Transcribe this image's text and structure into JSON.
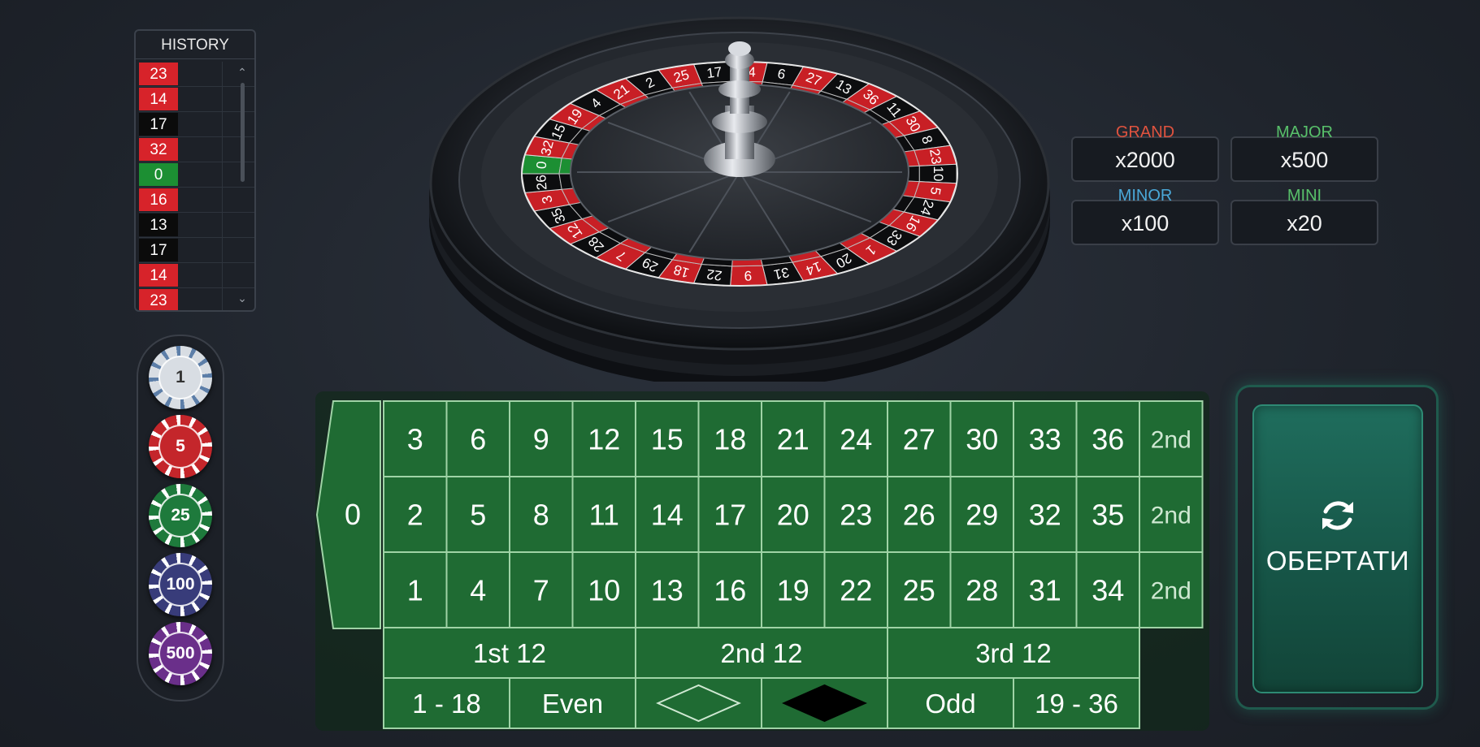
{
  "history": {
    "title": "HISTORY",
    "items": [
      {
        "num": "23",
        "color": "red"
      },
      {
        "num": "14",
        "color": "red"
      },
      {
        "num": "17",
        "color": "black"
      },
      {
        "num": "32",
        "color": "red"
      },
      {
        "num": "0",
        "color": "green"
      },
      {
        "num": "16",
        "color": "red"
      },
      {
        "num": "13",
        "color": "black"
      },
      {
        "num": "17",
        "color": "black"
      },
      {
        "num": "14",
        "color": "red"
      },
      {
        "num": "23",
        "color": "red"
      }
    ]
  },
  "chips": [
    {
      "value": "1",
      "color": "#d8dde3",
      "text": "#333333",
      "edge": "#5c7ea8"
    },
    {
      "value": "5",
      "color": "#c4262b",
      "text": "#ffffff",
      "edge": "#ffffff"
    },
    {
      "value": "25",
      "color": "#1e7a3c",
      "text": "#ffffff",
      "edge": "#ffffff"
    },
    {
      "value": "100",
      "color": "#383c7a",
      "text": "#ffffff",
      "edge": "#ffffff"
    },
    {
      "value": "500",
      "color": "#6a2f8a",
      "text": "#ffffff",
      "edge": "#ffffff"
    }
  ],
  "wheel": {
    "numbers_visible": [
      "0",
      "32",
      "15",
      "19",
      "4",
      "21",
      "2",
      "25",
      "17",
      "34",
      "6",
      "27",
      "13",
      "36",
      "11",
      "30",
      "8",
      "23",
      "10",
      "5",
      "24",
      "16",
      "33",
      "1",
      "20",
      "14",
      "31",
      "9",
      "22",
      "18",
      "29",
      "7",
      "28",
      "12",
      "35",
      "3",
      "26"
    ]
  },
  "jackpots": [
    {
      "name": "GRAND",
      "value": "x2000",
      "color": "#e0533f"
    },
    {
      "name": "MAJOR",
      "value": "x500",
      "color": "#58c06a"
    },
    {
      "name": "MINOR",
      "value": "x100",
      "color": "#4aa8d8"
    },
    {
      "name": "MINI",
      "value": "x20",
      "color": "#58c06a"
    }
  ],
  "table": {
    "zero": "0",
    "rows": [
      [
        "3",
        "6",
        "9",
        "12",
        "15",
        "18",
        "21",
        "24",
        "27",
        "30",
        "33",
        "36"
      ],
      [
        "2",
        "5",
        "8",
        "11",
        "14",
        "17",
        "20",
        "23",
        "26",
        "29",
        "32",
        "35"
      ],
      [
        "1",
        "4",
        "7",
        "10",
        "13",
        "16",
        "19",
        "22",
        "25",
        "28",
        "31",
        "34"
      ]
    ],
    "column_bets": [
      "2nd",
      "2nd",
      "2nd"
    ],
    "dozens": [
      "1st 12",
      "2nd 12",
      "3rd 12"
    ],
    "outside": [
      "1 - 18",
      "Even",
      "",
      "",
      "Odd",
      "19 - 36"
    ],
    "felt_color": "#1f6b33"
  },
  "spin": {
    "label": "ОБЕРТАТИ"
  }
}
